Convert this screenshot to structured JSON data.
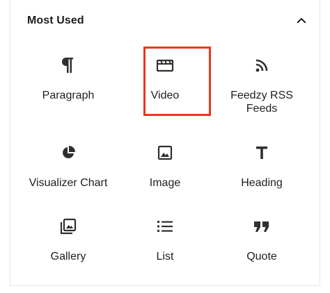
{
  "section": {
    "title": "Most Used",
    "toggle_icon": "chevron-up-icon"
  },
  "blocks": [
    {
      "label": "Paragraph",
      "icon": "paragraph-icon"
    },
    {
      "label": "Video",
      "icon": "video-icon",
      "highlighted": true
    },
    {
      "label": "Feedzy RSS Feeds",
      "icon": "rss-icon"
    },
    {
      "label": "Visualizer Chart",
      "icon": "pie-chart-icon"
    },
    {
      "label": "Image",
      "icon": "image-icon"
    },
    {
      "label": "Heading",
      "icon": "heading-icon"
    },
    {
      "label": "Gallery",
      "icon": "gallery-icon"
    },
    {
      "label": "List",
      "icon": "list-icon"
    },
    {
      "label": "Quote",
      "icon": "quote-icon"
    }
  ],
  "colors": {
    "text": "#1e1e1e",
    "icon": "#1e1e1e",
    "highlight": "#e8371d"
  }
}
